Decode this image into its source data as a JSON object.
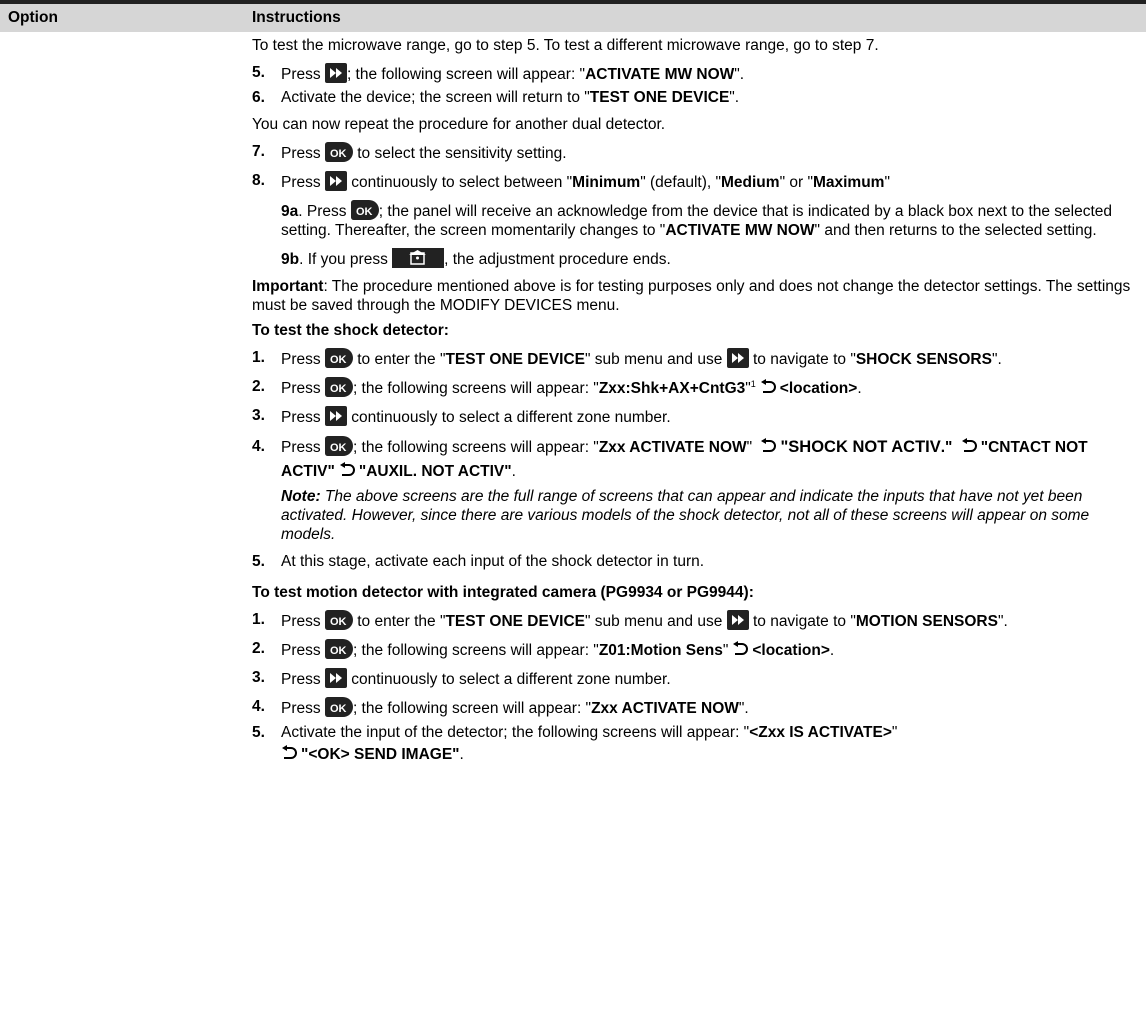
{
  "header": {
    "option": "Option",
    "instructions": "Instructions"
  },
  "icons": {
    "ff": "fast-forward-key-icon",
    "ok": "ok-key-icon",
    "home": "home-key-icon",
    "return": "return-arrow-icon"
  },
  "intro": {
    "text": "To test the microwave range, go to step 5. To test a different microwave range, go to step 7."
  },
  "mw": {
    "s5": {
      "num": "5.",
      "t1": "Press ",
      "t2": "; the following screen will appear: \"",
      "b1": "ACTIVATE MW NOW",
      "t3": "\"."
    },
    "s6": {
      "num": "6.",
      "t1": "Activate the device; the screen will return to \"",
      "b1": "TEST ONE DEVICE",
      "t2": "\"."
    },
    "repeat": "You can now repeat the procedure for another dual detector.",
    "s7": {
      "num": "7.",
      "t1": "Press ",
      "t2": " to select the sensitivity setting."
    },
    "s8": {
      "num": "8.",
      "t1": "Press ",
      "t2": " continuously to select between \"",
      "b1": "Minimum",
      "t3": "\" (default), \"",
      "b2": "Medium",
      "t4": "\" or \"",
      "b3": "Maximum",
      "t5": "\""
    },
    "s9a": {
      "num": "9a",
      "t1": ". Press ",
      "t2": "; the panel will receive an acknowledge from the device that is indicated by a black box next to the selected setting. Thereafter, the screen momentarily changes to \"",
      "b1": "ACTIVATE MW NOW",
      "t3": "\" and then returns to the selected setting."
    },
    "s9b": {
      "num": "9b",
      "t1": ". If you press ",
      "t2": ", the adjustment procedure ends."
    },
    "important": {
      "label": "Important",
      "text": ": The procedure mentioned above is for testing purposes only and does not change the detector settings. The settings must be saved through the MODIFY DEVICES menu."
    }
  },
  "shock": {
    "heading": "To test the shock detector:",
    "s1": {
      "num": "1.",
      "t1": "Press ",
      "t2": " to enter the \"",
      "b1": "TEST ONE DEVICE",
      "t3": "\" sub menu and use ",
      "t4": " to navigate to \"",
      "b2": "SHOCK SENSORS",
      "t5": "\"."
    },
    "s2": {
      "num": "2.",
      "t1": "Press ",
      "t2": "; the following screens will appear: \"",
      "b1": "Zxx:Shk+AX+CntG3",
      "t3": "\"",
      "sup": "1",
      "b2": "<location>",
      "t4": "."
    },
    "s3": {
      "num": "3.",
      "t1": "Press ",
      "t2": " continuously to select a different zone number."
    },
    "s4": {
      "num": "4.",
      "t1": "Press ",
      "t2": "; the following screens will appear: \"",
      "b1": "Zxx ACTIVATE NOW",
      "t3": "\" ",
      "b2": "\"SHOCK NOT ACTIV",
      "t4": ".\" ",
      "b3": "\"CNTACT NOT ACTIV\"",
      "b4": "\"AUXIL. NOT ACTIV\"",
      "t5": "."
    },
    "note": {
      "label": "Note:",
      "text": " The above screens are the full range of screens that can appear and indicate the inputs that have not yet been activated. However, since there are various models of the shock detector, not all of these screens will appear on some models."
    },
    "s5": {
      "num": "5.",
      "t1": "At this stage, activate each input of the shock detector in turn."
    }
  },
  "motion": {
    "heading": "To test motion detector with integrated camera (PG9934 or PG9944):",
    "s1": {
      "num": "1.",
      "t1": "Press ",
      "t2": " to enter the \"",
      "b1": "TEST ONE DEVICE",
      "t3": "\" sub menu and use ",
      "t4": " to navigate to \"",
      "b2": "MOTION SENSORS",
      "t5": "\"."
    },
    "s2": {
      "num": "2.",
      "t1": "Press ",
      "t2": "; the following screens will appear: \"",
      "b1": "Z01:Motion Sens",
      "t3": "\"",
      "b2": "<location>",
      "t4": "."
    },
    "s3": {
      "num": "3.",
      "t1": "Press ",
      "t2": " continuously to select a different zone number."
    },
    "s4": {
      "num": "4.",
      "t1": "Press ",
      "t2": "; the following screen will appear: \"",
      "b1": "Zxx ACTIVATE NOW",
      "t3": "\"."
    },
    "s5": {
      "num": "5.",
      "t1": "Activate the input of the detector; the following screens will appear: \"",
      "b1": "<Zxx IS ACTIVATE>",
      "t2": "\"",
      "b2": "\"<OK> SEND IMAGE\"",
      "t3": "."
    }
  }
}
